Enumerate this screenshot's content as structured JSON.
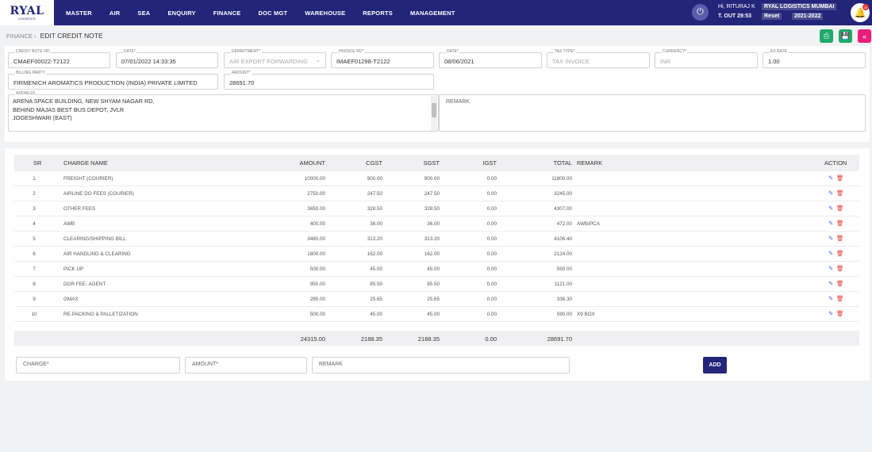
{
  "nav": {
    "logo": "RYAL",
    "logo_sub": "LOGISTICS",
    "menu": [
      "MASTER",
      "AIR",
      "SEA",
      "ENQUIRY",
      "FINANCE",
      "DOC MGT",
      "WAREHOUSE",
      "REPORTS",
      "MANAGEMENT"
    ],
    "greeting": "Hi, RITURAJ K",
    "timeout": "T. OUT 29:53",
    "company": "RYAL LOGISTICS MUMBAI",
    "reset": "Reset",
    "year": "2021-2022",
    "bell_badge": "19",
    "icons": {
      "power": "power-icon",
      "bell": "bell-icon"
    }
  },
  "breadcrumb": {
    "parent": "FINANCE",
    "sep": "›",
    "current": "EDIT CREDIT NOTE"
  },
  "actions": {
    "print_color": "#1faa6b",
    "save_color": "#1faa6b",
    "back_color": "#e91e7a"
  },
  "form": {
    "credit_note_no": {
      "label": "CREDIT NOTE NO",
      "value": "CMAEF00022-T2122"
    },
    "date": {
      "label": "DATE*",
      "value": "07/01/2022 14:33:35"
    },
    "department": {
      "label": "DEPARTMENT*",
      "value": "AIR EXPORT FORWARDING"
    },
    "invoice_no": {
      "label": "INVOICE NO*",
      "value": "IMAEF01298-T2122"
    },
    "invoice_date": {
      "label": "DATE*",
      "value": "08/06/2021"
    },
    "tax_type": {
      "label": "TAX TYPE*",
      "value": "TAX INVOICE"
    },
    "currency": {
      "label": "CURRENCY*",
      "value": "INR"
    },
    "ex_rate": {
      "label": "EX RATE",
      "value": "1.00"
    },
    "billing_party": {
      "label": "BILLING PARTY",
      "value": "FIRMENICH AROMATICS PRODUCTION (INDIA) PRIVATE LIMITED"
    },
    "amount": {
      "label": "AMOUNT*",
      "value": "28691.70"
    },
    "address": {
      "label": "ADDRESS",
      "lines": [
        "ARENA SPACE BUILDING, NEW SHYAM NAGAR RD,",
        "BEHIND MAJAS BEST BUS DEPOT, JVLR",
        "JOGESHWARI (EAST)"
      ]
    },
    "remark": {
      "placeholder": "REMARK"
    }
  },
  "table": {
    "headers": {
      "sr": "SR",
      "charge": "CHARGE NAME",
      "amount": "AMOUNT",
      "cgst": "CGST",
      "sgst": "SGST",
      "igst": "IGST",
      "total": "TOTAL",
      "remark": "REMARK",
      "action": "ACTION"
    },
    "rows": [
      {
        "sr": "1",
        "charge": "FREIGHT (COURIER)",
        "amount": "10000.00",
        "cgst": "900.00",
        "sgst": "900.00",
        "igst": "0.00",
        "total": "11800.00",
        "remark": ""
      },
      {
        "sr": "2",
        "charge": "AIRLINE DO FEES (COURIER)",
        "amount": "2750.00",
        "cgst": "247.50",
        "sgst": "247.50",
        "igst": "0.00",
        "total": "3245.00",
        "remark": ""
      },
      {
        "sr": "3",
        "charge": "OTHER FEES",
        "amount": "3650.00",
        "cgst": "328.50",
        "sgst": "328.50",
        "igst": "0.00",
        "total": "4307.00",
        "remark": ""
      },
      {
        "sr": "4",
        "charge": "AWB",
        "amount": "400.00",
        "cgst": "36.00",
        "sgst": "36.00",
        "igst": "0.00",
        "total": "472.00",
        "remark": "AWB/PCA"
      },
      {
        "sr": "5",
        "charge": "CLEARING/SHIPPING BILL",
        "amount": "3480.00",
        "cgst": "313.20",
        "sgst": "313.20",
        "igst": "0.00",
        "total": "4106.40",
        "remark": ""
      },
      {
        "sr": "6",
        "charge": "AIR HANDLING & CLEARING",
        "amount": "1800.00",
        "cgst": "162.00",
        "sgst": "162.00",
        "igst": "0.00",
        "total": "2124.00",
        "remark": ""
      },
      {
        "sr": "7",
        "charge": "PICK UP",
        "amount": "500.00",
        "cgst": "45.00",
        "sgst": "45.00",
        "igst": "0.00",
        "total": "590.00",
        "remark": ""
      },
      {
        "sr": "8",
        "charge": "DGR FEE- AGENT",
        "amount": "950.00",
        "cgst": "85.50",
        "sgst": "85.50",
        "igst": "0.00",
        "total": "1121.00",
        "remark": ""
      },
      {
        "sr": "9",
        "charge": "GMAX",
        "amount": "285.00",
        "cgst": "25.65",
        "sgst": "25.65",
        "igst": "0.00",
        "total": "336.30",
        "remark": ""
      },
      {
        "sr": "10",
        "charge": "RE-PACKING & PALLETIZATION",
        "amount": "500.00",
        "cgst": "45.00",
        "sgst": "45.00",
        "igst": "0.00",
        "total": "590.00",
        "remark": "X9 BOX"
      }
    ],
    "totals": {
      "amount": "24315.00",
      "cgst": "2188.35",
      "sgst": "2188.35",
      "igst": "0.00",
      "total": "28691.70"
    }
  },
  "add_form": {
    "charge_placeholder": "CHARGE*",
    "amount_placeholder": "AMOUNT*",
    "remark_placeholder": "REMARK",
    "add_label": "ADD"
  }
}
